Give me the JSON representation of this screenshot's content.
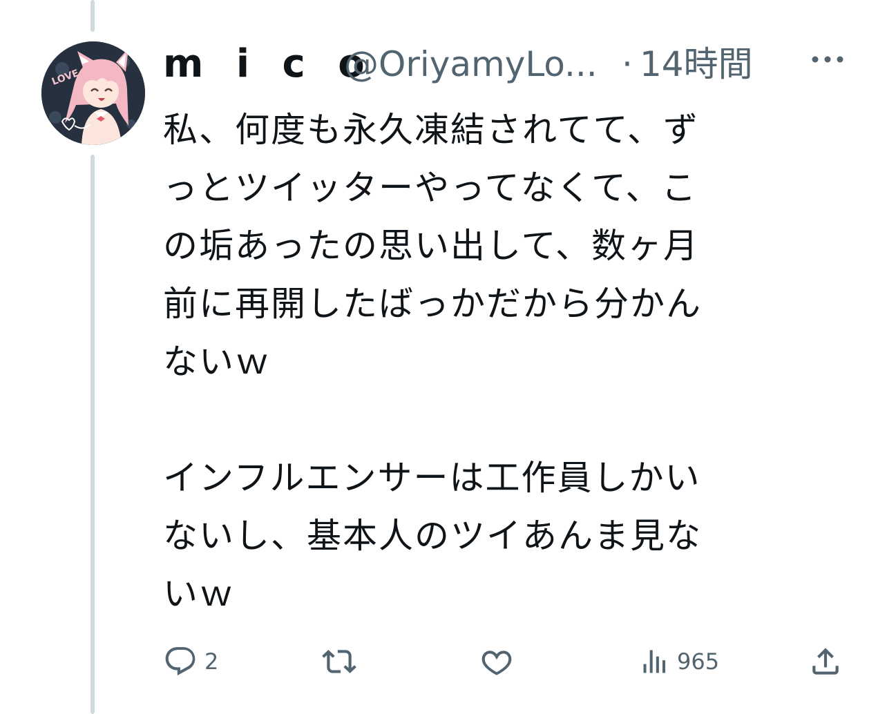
{
  "tweet": {
    "display_name": "m i c o",
    "handle": "@OriyamyLo...",
    "separator": "·",
    "time": "14時間",
    "text": "私、何度も永久凍結されてて、ず\nっとツイッターやってなくて、こ\nの垢あったの思い出して、数ヶ月\n前に再開したばっかだから分かん\nないｗ\n\nインフルエンサーは工作員しかい\nないし、基本人のツイあんま見な\nいｗ",
    "avatar_text": "LOVE"
  },
  "actions": {
    "reply_count": "2",
    "retweet_count": "",
    "like_count": "",
    "view_count": "965"
  },
  "icons": {
    "more": "more-dots-icon",
    "reply": "reply-bubble-icon",
    "retweet": "retweet-icon",
    "like": "heart-icon",
    "views": "views-bar-chart-icon",
    "share": "share-upload-icon"
  },
  "colors": {
    "text_primary": "#0f1419",
    "text_secondary": "#536471",
    "thread_line": "#cfd9de"
  }
}
